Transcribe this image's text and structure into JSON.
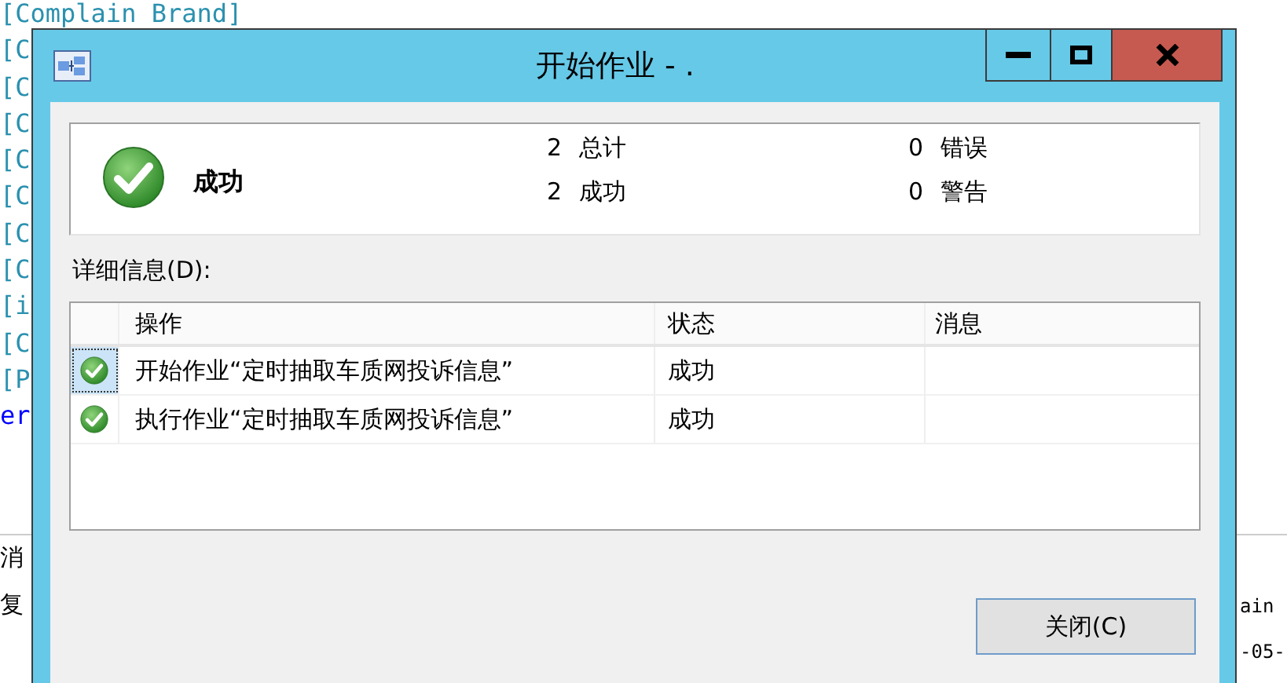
{
  "background_editor": {
    "lines": [
      {
        "text": "[Complain Brand]",
        "kind": "code"
      },
      {
        "text": "[C",
        "kind": "code"
      },
      {
        "text": "[C",
        "kind": "code"
      },
      {
        "text": "[C",
        "kind": "code"
      },
      {
        "text": "[C",
        "kind": "code"
      },
      {
        "text": "[C",
        "kind": "code"
      },
      {
        "text": "[C",
        "kind": "code"
      },
      {
        "text": "[C",
        "kind": "code"
      },
      {
        "text": "[i",
        "kind": "code"
      },
      {
        "text": "[C",
        "kind": "code"
      },
      {
        "text": "[P",
        "kind": "code"
      },
      {
        "text": "er",
        "kind": "keyword"
      }
    ],
    "lower_left": [
      "消",
      "复"
    ],
    "lower_right": [
      "ain",
      "-05-"
    ]
  },
  "window": {
    "title": "开始作业 - ."
  },
  "summary": {
    "status": "成功",
    "kind": "success",
    "counts": [
      "2 总计",
      "0 错误",
      "2 成功",
      "0 警告"
    ]
  },
  "details_label": "详细信息(D):",
  "table": {
    "columns": [
      "操作",
      "状态",
      "消息"
    ],
    "rows": [
      {
        "kind": "success",
        "selected": true,
        "action": "开始作业“定时抽取车质网投诉信息”",
        "status": "成功"
      },
      {
        "kind": "success",
        "selected": false,
        "action": "执行作业“定时抽取车质网投诉信息”",
        "status": "成功"
      }
    ]
  },
  "buttons": [
    "关闭(C)"
  ]
}
